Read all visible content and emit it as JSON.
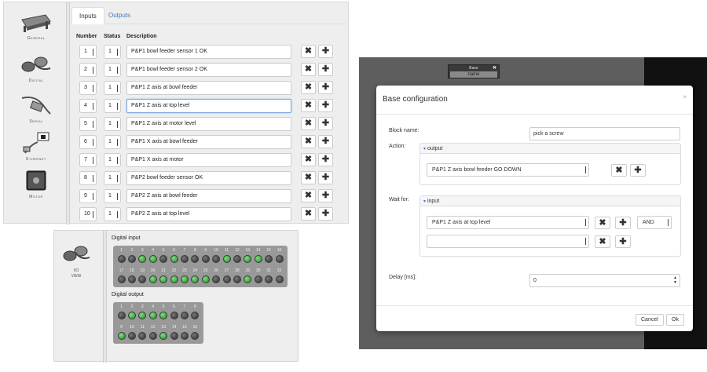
{
  "sidebar": {
    "items": [
      {
        "label": "General",
        "icon": "conveyor-icon"
      },
      {
        "label": "Digital",
        "icon": "connector-cable-icon"
      },
      {
        "label": "Serial",
        "icon": "serial-cable-icon"
      },
      {
        "label": "Ethernet",
        "icon": "ethernet-cable-icon"
      },
      {
        "label": "Motor",
        "icon": "stepper-motor-icon"
      }
    ]
  },
  "tabs": [
    {
      "label": "Inputs",
      "active": true
    },
    {
      "label": "Outputs",
      "active": false
    }
  ],
  "table": {
    "headers": {
      "number": "Number",
      "status": "Status",
      "description": "Description"
    },
    "rows": [
      {
        "number": "1",
        "status": "1",
        "description": "P&P1 bowl feeder sensor 1 OK"
      },
      {
        "number": "2",
        "status": "1",
        "description": "P&P1 bowl feeder sensor 2 OK"
      },
      {
        "number": "3",
        "status": "1",
        "description": "P&P1 Z axis at bowl feeder"
      },
      {
        "number": "4",
        "status": "1",
        "description": "P&P1 Z axis at top level"
      },
      {
        "number": "5",
        "status": "1",
        "description": "P&P1 Z axis at motor level"
      },
      {
        "number": "6",
        "status": "1",
        "description": "P&P1 X axis at bowl feeder"
      },
      {
        "number": "7",
        "status": "1",
        "description": "P&P1 X axis at motor"
      },
      {
        "number": "8",
        "status": "1",
        "description": "P&P2 bowl feeder sensor OK"
      },
      {
        "number": "9",
        "status": "1",
        "description": "P&P2 Z axis at bowl feeder"
      },
      {
        "number": "10",
        "status": "1",
        "description": "P&P2 Z axis at top level"
      }
    ],
    "delete_icon": "✖",
    "add_icon": "✚"
  },
  "io_view": {
    "icon_label_line1": "I/O",
    "icon_label_line2": "VIEW",
    "digital_input": {
      "title": "Digital input",
      "numbers_row1": [
        "1",
        "2",
        "3",
        "4",
        "5",
        "6",
        "7",
        "8",
        "9",
        "10",
        "11",
        "12",
        "13",
        "14",
        "15",
        "16"
      ],
      "states_row1": [
        0,
        0,
        1,
        1,
        0,
        1,
        0,
        0,
        0,
        0,
        1,
        0,
        1,
        1,
        0,
        0
      ],
      "numbers_row2": [
        "17",
        "18",
        "19",
        "20",
        "21",
        "22",
        "23",
        "24",
        "25",
        "26",
        "27",
        "28",
        "29",
        "30",
        "31",
        "32"
      ],
      "states_row2": [
        0,
        0,
        0,
        1,
        1,
        1,
        1,
        1,
        1,
        0,
        0,
        0,
        1,
        0,
        0,
        0
      ]
    },
    "digital_output": {
      "title": "Digital output",
      "numbers_row1": [
        "1",
        "2",
        "3",
        "4",
        "5",
        "6",
        "7",
        "8"
      ],
      "states_row1": [
        0,
        1,
        1,
        1,
        1,
        0,
        0,
        0
      ],
      "numbers_row2": [
        "9",
        "10",
        "11",
        "12",
        "13",
        "14",
        "15",
        "16"
      ],
      "states_row2": [
        1,
        0,
        0,
        0,
        1,
        0,
        0,
        0
      ]
    },
    "colors": {
      "led_on": "#2fa52f",
      "led_off": "#3c3c3c",
      "panel": "#999999"
    }
  },
  "base_block": {
    "title": "Base",
    "name": "name",
    "close": "✖"
  },
  "modal": {
    "title": "Base configuration",
    "close": "×",
    "block_name_label": "Block name:",
    "block_name_value": "pick a screw",
    "action_label": "Action:",
    "output_header": "output",
    "output_select": "P&P1 Z axis bowl feeder GO DOWN",
    "wait_label": "Wait for:",
    "input_header": "input",
    "input_select_1": "P&P1 Z axis at top level",
    "input_select_2": "",
    "logic_select": "AND",
    "delay_label": "Delay [ms]:",
    "delay_value": "0",
    "cancel_label": "Cancel",
    "ok_label": "Ok",
    "caret": "▾",
    "spin_up": "▲",
    "spin_down": "▼"
  }
}
